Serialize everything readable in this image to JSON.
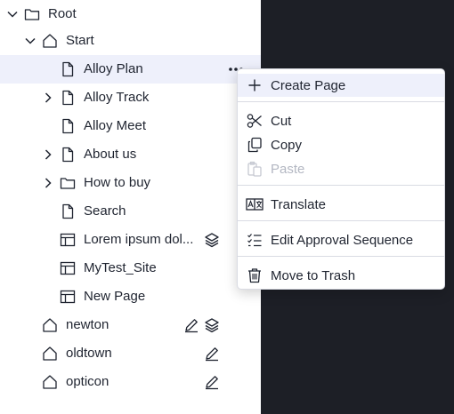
{
  "tree": {
    "root": "Root",
    "start": "Start",
    "items": [
      "Alloy Plan",
      "Alloy Track",
      "Alloy Meet",
      "About us",
      "How to buy",
      "Search",
      "Lorem ipsum dol...",
      "MyTest_Site",
      "New Page"
    ],
    "sites": [
      "newton",
      "oldtown",
      "opticon"
    ]
  },
  "context_menu": {
    "create_page": "Create Page",
    "cut": "Cut",
    "copy": "Copy",
    "paste": "Paste",
    "translate": "Translate",
    "edit_approval_sequence": "Edit Approval Sequence",
    "move_to_trash": "Move to Trash"
  },
  "colors": {
    "selected_row": "#eef0fb",
    "dark_panel": "#1d1f26",
    "disabled_text": "#b3b7c2"
  }
}
